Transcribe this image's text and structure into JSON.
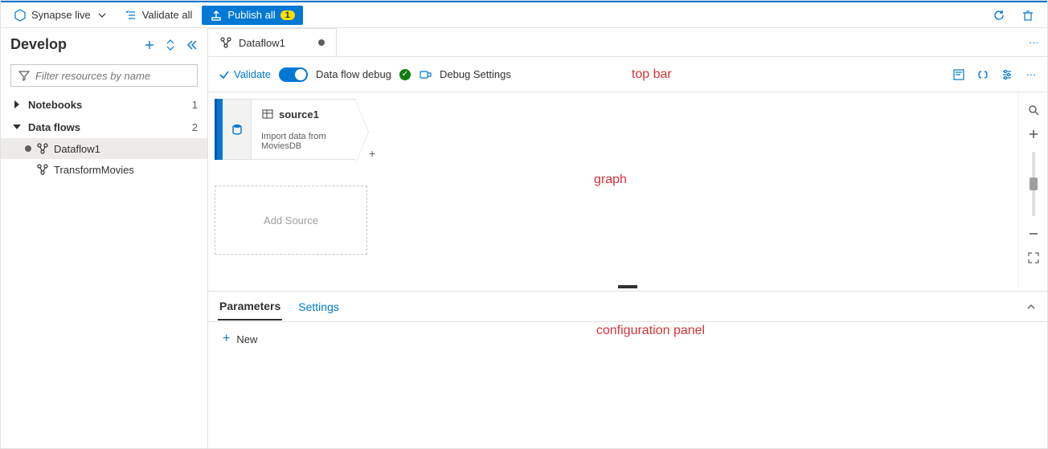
{
  "toolbar": {
    "workspace_label": "Synapse live",
    "validate_all_label": "Validate all",
    "publish_label": "Publish all",
    "publish_badge": "1"
  },
  "sidebar": {
    "title": "Develop",
    "filter_placeholder": "Filter resources by name",
    "nodes": [
      {
        "label": "Notebooks",
        "count": "1",
        "expanded": false
      },
      {
        "label": "Data flows",
        "count": "2",
        "expanded": true
      }
    ],
    "dataflow_children": [
      {
        "label": "Dataflow1",
        "dirty": true,
        "selected": true
      },
      {
        "label": "TransformMovies",
        "dirty": false,
        "selected": false
      }
    ]
  },
  "tab": {
    "title": "Dataflow1"
  },
  "topbar": {
    "validate_label": "Validate",
    "debug_label": "Data flow debug",
    "debug_settings_label": "Debug Settings"
  },
  "graph": {
    "source_node": {
      "title": "source1",
      "description": "Import data from MoviesDB"
    },
    "add_source_label": "Add Source"
  },
  "config": {
    "tabs": {
      "parameters": "Parameters",
      "settings": "Settings"
    },
    "new_label": "New"
  },
  "annotations": {
    "topbar": "top bar",
    "graph": "graph",
    "config": "configuration panel"
  }
}
